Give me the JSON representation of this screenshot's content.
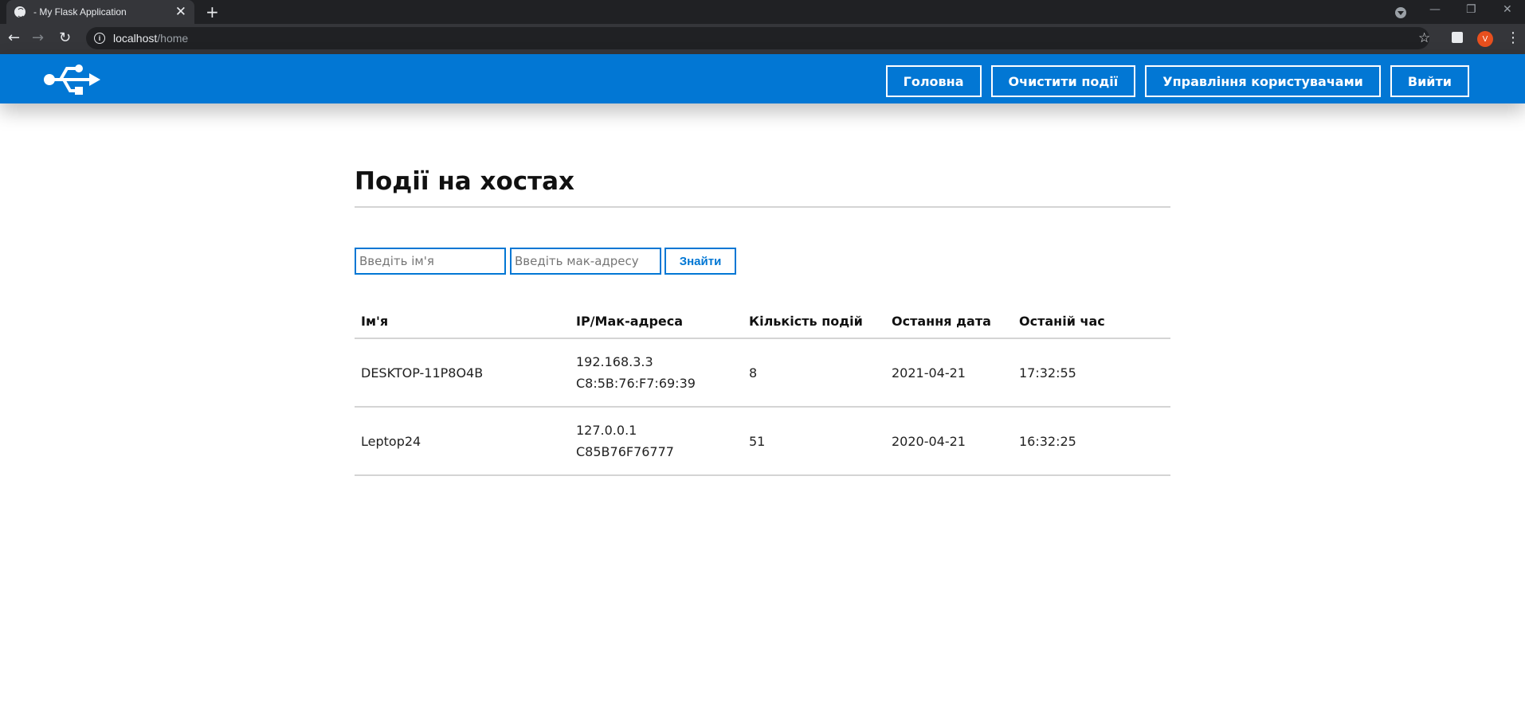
{
  "browser": {
    "tab_title": "- My Flask Application",
    "tab_close": "✕",
    "new_tab": "+",
    "url_host": "localhost",
    "url_path": "/home",
    "profile_initial": "V",
    "window_controls": [
      "—",
      "❐",
      "✕"
    ]
  },
  "header": {
    "logo_icon": "usb-icon",
    "brand_color": "#0277d4",
    "nav": [
      "Головна",
      "Очистити події",
      "Управління користувачами",
      "Вийти"
    ]
  },
  "main": {
    "title": "Події на хостах",
    "search": {
      "name_placeholder": "Введіть ім'я",
      "mac_placeholder": "Введіть мак-адресу",
      "button_label": "Знайти"
    },
    "table": {
      "columns": [
        "Ім'я",
        "IP/Мак-адреса",
        "Кількість подій",
        "Остання дата",
        "Останій час"
      ],
      "rows": [
        {
          "name": "DESKTOP-11P8O4B",
          "ip": "192.168.3.3",
          "mac": "C8:5B:76:F7:69:39",
          "events": "8",
          "date": "2021-04-21",
          "time": "17:32:55"
        },
        {
          "name": "Leptop24",
          "ip": "127.0.0.1",
          "mac": "C85B76F76777",
          "events": "51",
          "date": "2020-04-21",
          "time": "16:32:25"
        }
      ]
    }
  }
}
